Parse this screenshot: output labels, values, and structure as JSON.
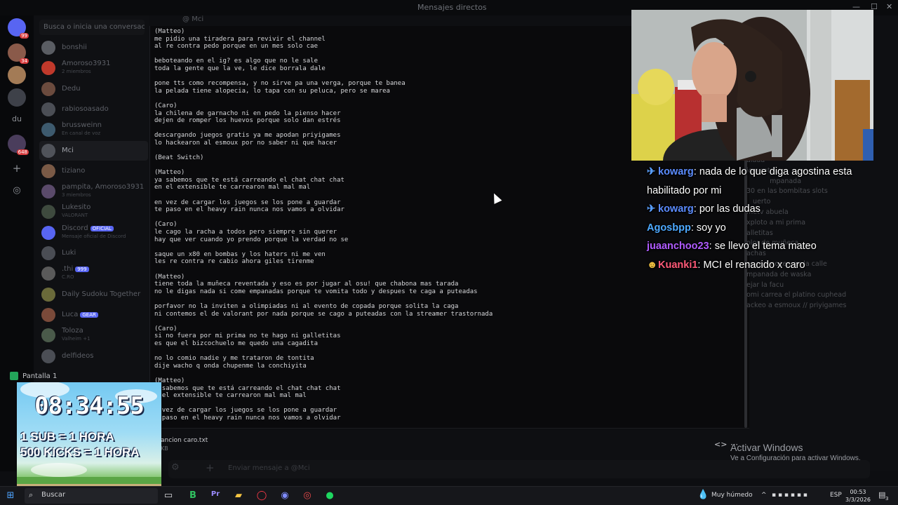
{
  "window": {
    "title": "Mensajes directos"
  },
  "header": {
    "dm_tab": "Mci"
  },
  "rail": {
    "badge1": "99",
    "badge2": "34",
    "label_du": "du",
    "badge3": "648"
  },
  "dm_list": {
    "search_placeholder": "Busca o inicia una conversación",
    "items": [
      {
        "name": "bonshii",
        "sub": ""
      },
      {
        "name": "Amoroso3931",
        "sub": "2 miembros"
      },
      {
        "name": "Dedu",
        "sub": ""
      },
      {
        "name": "rabiosoasado",
        "sub": ""
      },
      {
        "name": "brussweinn",
        "sub": "En canal de voz"
      },
      {
        "name": "Mci",
        "sub": ""
      },
      {
        "name": "tiziano",
        "sub": ""
      },
      {
        "name": "pampita, Amoroso3931",
        "sub": "3 miembros"
      },
      {
        "name": "Lukesito",
        "sub": "VALORANT"
      },
      {
        "name": "Discord",
        "tag": "OFICIAL",
        "sub": "Mensaje oficial de Discord"
      },
      {
        "name": "Luki",
        "sub": ""
      },
      {
        "name": ".thi",
        "tag": "999",
        "sub": "C.RO"
      },
      {
        "name": "Daily Sudoku Together",
        "sub": ""
      },
      {
        "name": "Luca",
        "tag": "GEAR",
        "sub": ""
      },
      {
        "name": "Toloza",
        "sub": "Valheim +1"
      },
      {
        "name": "delfideos",
        "sub": ""
      }
    ]
  },
  "file_preview": {
    "lyrics": "(Matteo)\nme pidio una tiradera para revivir el channel\nal re contra pedo porque en un mes solo cae\n\nbeboteando en el ig? es algo que no le sale\ntoda la gente que la ve, le dice borrala dale\n\npone tts como recompensa, y no sirve pa una verga, porque te banea\nla pelada tiene alopecia, lo tapa con su peluca, pero se marea\n\n(Caro)\nla chilena de garnacho ni en pedo la pienso hacer\ndejen de romper los huevos porque solo dan estrés\n\ndescargando juegos gratis ya me apodan priyigames\nlo hackearon al esmoux por no saber ni que hacer\n\n(Beat Switch)\n\n(Matteo)\nya sabemos que te está carreando el chat chat chat\nen el extensible te carrearon mal mal mal\n\nen vez de cargar los juegos se los pone a guardar\nte paso en el heavy rain nunca nos vamos a olvidar\n\n(Caro)\nle cago la racha a todos pero siempre sin querer\nhay que ver cuando yo prendo porque la verdad no se\n\nsaque un x80 en bombas y los haters ni me ven\nles re contra re cabio ahora giles tirenme\n\n(Matteo)\ntiene toda la muñeca reventada y eso es por jugar al osu! que chabona mas tarada\nno le digas nada si come empanadas porque te vomita todo y despues te caga a puteadas\n\nporfavor no la inviten a olimpiadas ni al evento de copada porque solita la caga\nni contemos el de valorant por nada porque se cago a puteadas con la streamer trastornada\n\n(Caro)\nsi no fuera por mi prima no te hago ni galletitas\nes que el bizcochuelo me quedo una cagadita\n\nno lo comio nadie y me trataron de tontita\ndije wacho q onda chupenme la conchiyita\n\n(Matteo)\n  sabemos que te está carreando el chat chat chat\n  el extensible te carrearon mal mal mal\n\n  vez de cargar los juegos se los pone a guardar\n  paso en el heavy rain nunca nos vamos a olvidar",
    "file_name": "ancion caro.txt",
    "file_size": "KB",
    "code_icon": "<>",
    "more_icon": "⋯"
  },
  "composer": {
    "placeholder": "Enviar mensaje a @Mci"
  },
  "twitch_chat": [
    {
      "pin": true,
      "user": "kowarg",
      "color": "#5b8cff",
      "text": ": nada de lo que diga agostina esta habilitado por mi"
    },
    {
      "pin": true,
      "user": "kowarg",
      "color": "#5b8cff",
      "text": ": por las dudas"
    },
    {
      "pin": false,
      "user": "Agosbpp",
      "color": "#4da9ff",
      "text": ": soy yo"
    },
    {
      "pin": false,
      "user": "juaanchoo23",
      "color": "#b05bff",
      "text": ": se llevo el tema mateo"
    },
    {
      "pin": false,
      "emote": true,
      "user": "Kuanki1",
      "color": "#ff5a78",
      "text": ": MCI el renacido x caro"
    }
  ],
  "ghost_text": "alada\nicro roto\n           mpanada\n30 en las bombitas slots\n   uerto\nmetv abuela\nxploto a mi prima\nalletitas\nolor de muñeca\nachas\nse reconocen en la calle\nmpanada de waska\nejar la facu\nomi carrea el platino cuphead\nackeo a esmoux // priyigames",
  "timer": {
    "time": "08:34:55",
    "line1": "1 SUB = 1 HORA",
    "line2": "500 KICKS = 1 HORA"
  },
  "screen_share": {
    "label": "Pantalla 1"
  },
  "watermark": {
    "line1": "Activar Windows",
    "line2": "Ve a Configuración para activar Windows."
  },
  "taskbar": {
    "search": "Buscar",
    "weather": "Muy húmedo",
    "lang": "ESP",
    "time": "00:53",
    "date": "3/3/2026",
    "notif": "3"
  }
}
